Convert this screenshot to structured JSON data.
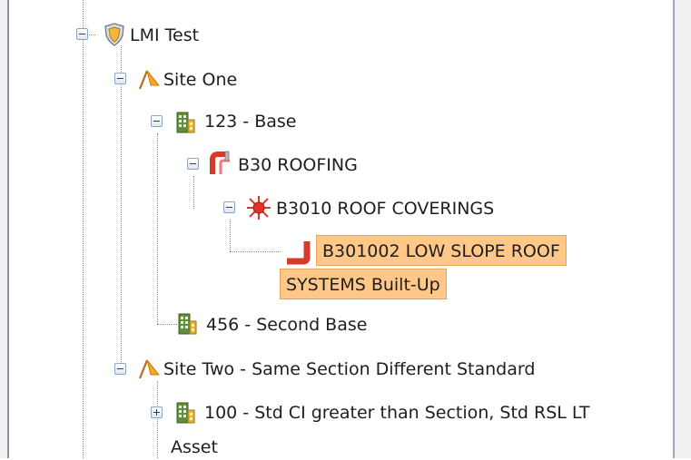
{
  "tree": {
    "root": {
      "label": "LMI Test",
      "icon": "shield-icon"
    },
    "site_one": {
      "label": "Site One",
      "icon": "site-flag-icon"
    },
    "base_123": {
      "label": "123 - Base",
      "icon": "building-icon"
    },
    "b30": {
      "label": "B30 ROOFING",
      "icon": "roofing-pipe-icon"
    },
    "b3010": {
      "label": "B3010 ROOF COVERINGS",
      "icon": "component-star-icon"
    },
    "b301002": {
      "label_line1": "B301002 LOW SLOPE ROOF",
      "label_line2": "SYSTEMS Built-Up",
      "icon": "section-pipe-icon",
      "selected": true
    },
    "base_456": {
      "label": "456 - Second Base",
      "icon": "building-icon"
    },
    "site_two": {
      "label": "Site Two - Same Section Different Standard",
      "icon": "site-flag-icon"
    },
    "base_100": {
      "label_line1": "100 - Std CI greater than Section, Std RSL LT",
      "label_line2": "Asset",
      "icon": "building-icon"
    }
  },
  "colors": {
    "selection_fill": "#ffc889",
    "selection_border": "#e8a55a"
  }
}
